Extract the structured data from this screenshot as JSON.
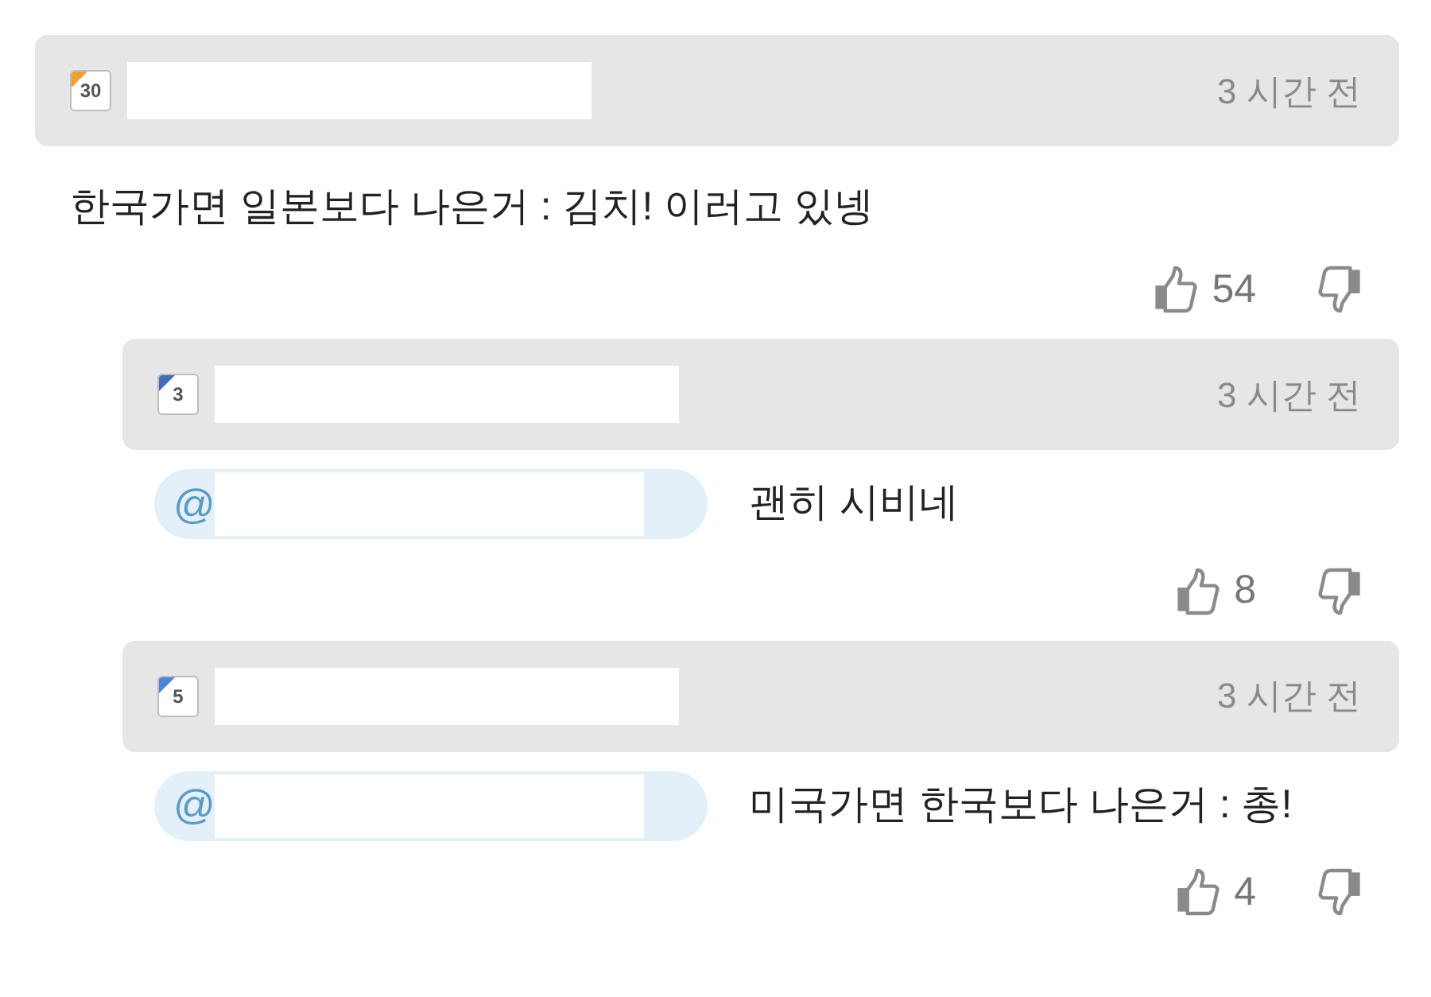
{
  "comment": {
    "level": "30",
    "color": "#f0a030",
    "time": "3 시간 전",
    "text": "한국가면 일본보다 나은거 : 김치! 이러고 있넹",
    "likes": "54"
  },
  "replies": [
    {
      "level": "3",
      "color": "#3f6fb8",
      "time": "3 시간 전",
      "mention": "@",
      "text": "괜히 시비네",
      "likes": "8"
    },
    {
      "level": "5",
      "color": "#4a86d8",
      "time": "3 시간 전",
      "mention": "@",
      "text": "미국가면 한국보다 나은거 : 총!",
      "likes": "4"
    }
  ]
}
